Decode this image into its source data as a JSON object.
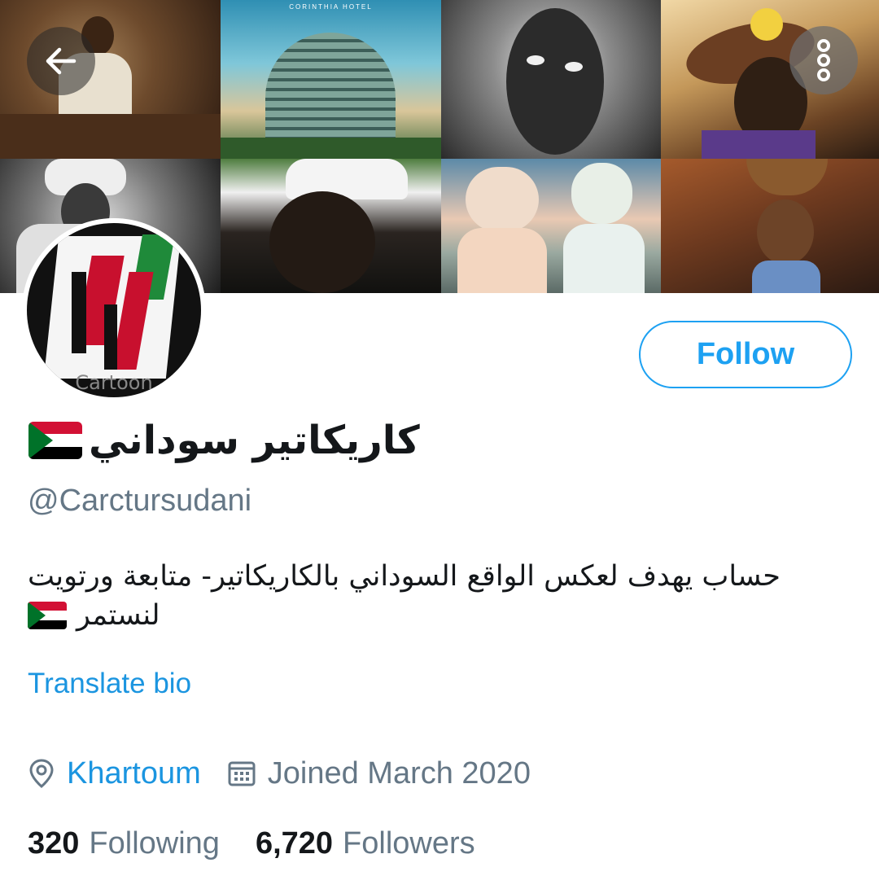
{
  "header": {
    "back_icon": "arrow-left-icon",
    "more_icon": "vertical-ellipsis-icon",
    "tile_caption": "CORINTHIA HOTEL"
  },
  "avatar": {
    "caption": "Cartoon"
  },
  "follow_button": {
    "label": "Follow",
    "color": "#1da1f2"
  },
  "profile": {
    "display_name": "كاريكاتير سوداني",
    "name_emoji": "flag-sudan",
    "handle": "@Carctursudani",
    "bio_line1": "حساب يهدف لعكس الواقع السوداني بالكاريكاتير- متابعة ورتويت",
    "bio_line2": "لنستمر",
    "bio_emoji": "flag-sudan",
    "translate_label": "Translate bio",
    "location": "Khartoum",
    "location_icon": "map-pin-icon",
    "joined": "Joined March 2020",
    "joined_icon": "calendar-icon"
  },
  "stats": {
    "following_count": "320",
    "following_label": "Following",
    "followers_count": "6,720",
    "followers_label": "Followers"
  },
  "colors": {
    "accent": "#1da1f2",
    "link": "#1b95e0",
    "secondary_text": "#657786",
    "primary_text": "#14171a"
  }
}
